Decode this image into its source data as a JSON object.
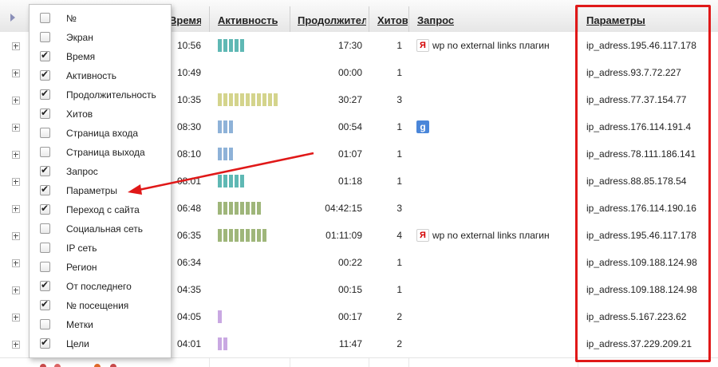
{
  "header": {
    "columns": {
      "time": "Время",
      "activity": "Активность",
      "duration": "Продолжител",
      "hits": "Хитов",
      "query": "Запрос",
      "params": "Параметры"
    }
  },
  "colors": {
    "teal": "#5fb8b4",
    "blue": "#8eb2d8",
    "olive_light": "#d4d48c",
    "olive": "#9fb67a",
    "lilac": "#c9a8e2",
    "highlight_red": "#e01818"
  },
  "menu": {
    "items": [
      {
        "label": "№",
        "checked": false
      },
      {
        "label": "Экран",
        "checked": false
      },
      {
        "label": "Время",
        "checked": true
      },
      {
        "label": "Активность",
        "checked": true
      },
      {
        "label": "Продолжительность",
        "checked": true
      },
      {
        "label": "Хитов",
        "checked": true
      },
      {
        "label": "Страница входа",
        "checked": false
      },
      {
        "label": "Страница выхода",
        "checked": false
      },
      {
        "label": "Запрос",
        "checked": true
      },
      {
        "label": "Параметры",
        "checked": true
      },
      {
        "label": "Переход с сайта",
        "checked": true
      },
      {
        "label": "Социальная сеть",
        "checked": false
      },
      {
        "label": "IP сеть",
        "checked": false
      },
      {
        "label": "Регион",
        "checked": false
      },
      {
        "label": "От последнего",
        "checked": true
      },
      {
        "label": "№ посещения",
        "checked": true
      },
      {
        "label": "Метки",
        "checked": false
      },
      {
        "label": "Цели",
        "checked": true
      }
    ]
  },
  "rows": [
    {
      "time": "10:56",
      "bars": 5,
      "bar_color": "teal",
      "duration": "17:30",
      "hits": "1",
      "query_icon": "yandex-icon",
      "query": "wp no external links плагин",
      "params": "ip_adress.195.46.117.178"
    },
    {
      "time": "10:49",
      "bars": 0,
      "bar_color": "teal",
      "duration": "00:00",
      "hits": "1",
      "query_icon": "",
      "query": "",
      "params": "ip_adress.93.7.72.227"
    },
    {
      "time": "10:35",
      "bars": 11,
      "bar_color": "olive_light",
      "duration": "30:27",
      "hits": "3",
      "query_icon": "",
      "query": "",
      "params": "ip_adress.77.37.154.77"
    },
    {
      "time": "08:30",
      "bars": 3,
      "bar_color": "blue",
      "duration": "00:54",
      "hits": "1",
      "query_icon": "google-icon",
      "query": "",
      "params": "ip_adress.176.114.191.4"
    },
    {
      "time": "08:10",
      "bars": 3,
      "bar_color": "blue",
      "duration": "01:07",
      "hits": "1",
      "query_icon": "",
      "query": "",
      "params": "ip_adress.78.111.186.141"
    },
    {
      "time": "08:01",
      "bars": 5,
      "bar_color": "teal",
      "duration": "01:18",
      "hits": "1",
      "query_icon": "",
      "query": "",
      "params": "ip_adress.88.85.178.54"
    },
    {
      "time": "06:48",
      "bars": 8,
      "bar_color": "olive",
      "duration": "04:42:15",
      "hits": "3",
      "query_icon": "",
      "query": "",
      "params": "ip_adress.176.114.190.16"
    },
    {
      "time": "06:35",
      "bars": 9,
      "bar_color": "olive",
      "duration": "01:11:09",
      "hits": "4",
      "query_icon": "yandex-icon",
      "query": "wp no external links плагин",
      "params": "ip_adress.195.46.117.178"
    },
    {
      "time": "06:34",
      "bars": 0,
      "bar_color": "teal",
      "duration": "00:22",
      "hits": "1",
      "query_icon": "",
      "query": "",
      "params": "ip_adress.109.188.124.98"
    },
    {
      "time": "04:35",
      "bars": 0,
      "bar_color": "teal",
      "duration": "00:15",
      "hits": "1",
      "query_icon": "",
      "query": "",
      "params": "ip_adress.109.188.124.98"
    },
    {
      "time": "04:05",
      "bars": 1,
      "bar_color": "lilac",
      "duration": "00:17",
      "hits": "2",
      "query_icon": "",
      "query": "",
      "params": "ip_adress.5.167.223.62"
    },
    {
      "time": "04:01",
      "bars": 2,
      "bar_color": "lilac",
      "duration": "11:47",
      "hits": "2",
      "query_icon": "",
      "query": "",
      "params": "ip_adress.37.229.209.21"
    }
  ],
  "icons": {
    "yandex_glyph": "Я",
    "google_glyph": "g",
    "check_glyph": "✔"
  }
}
